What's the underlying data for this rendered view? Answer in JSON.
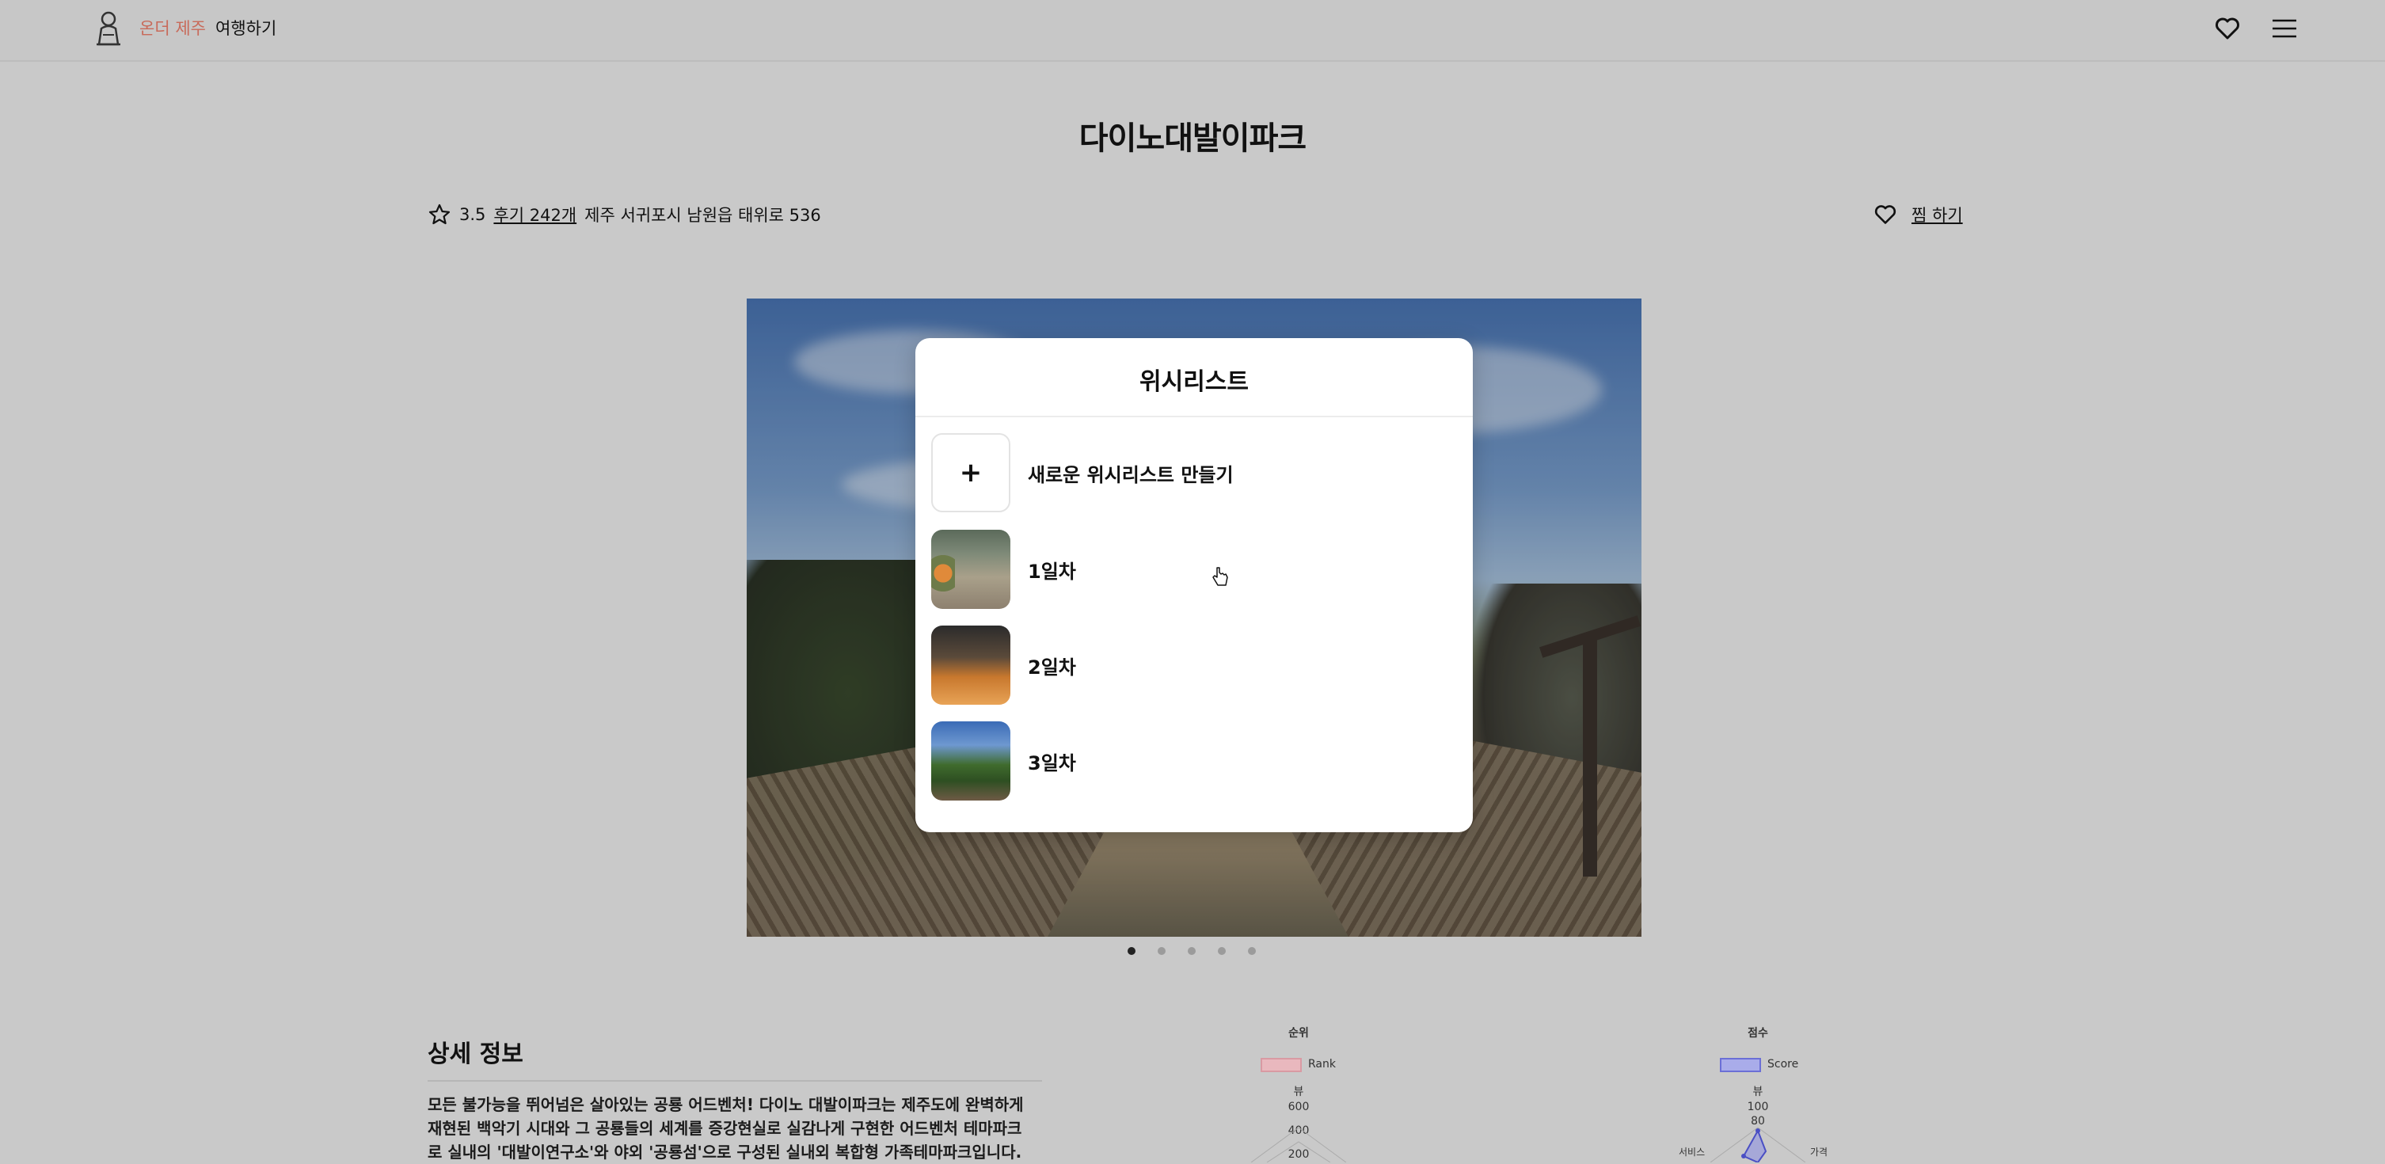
{
  "header": {
    "brand": "온더 제주",
    "nav_label": "여행하기"
  },
  "place": {
    "title": "다이노대발이파크",
    "rating": "3.5",
    "reviews": "후기 242개",
    "address": "제주 서귀포시 남원읍 태위로 536",
    "save_label": "찜 하기"
  },
  "carousel": {
    "total_slides": 5,
    "active_index": 0
  },
  "modal": {
    "title": "위시리스트",
    "create_label": "새로운 위시리스트 만들기",
    "items": [
      {
        "label": "1일차",
        "thumb_icon": "orange-farm-thumbnail"
      },
      {
        "label": "2일차",
        "thumb_icon": "tangerine-box-thumbnail"
      },
      {
        "label": "3일차",
        "thumb_icon": "field-path-thumbnail"
      }
    ]
  },
  "detail": {
    "title": "상세 정보",
    "lines": [
      "모든 불가능을 뛰어넘은 살아있는 공룡 어드벤처! 다이노 대발이파크는 제주도에 완벽하게",
      "재현된 백악기 시대와 그 공룡들의 세계를 증강현실로 실감나게 구현한 어드벤처 테마파크",
      "로 실내의 '대발이연구소'와 야외 '공룡섬'으로 구성된 실내외 복합형 가족테마파크입니다."
    ]
  },
  "charts": [
    {
      "title": "순위",
      "legend": "Rank",
      "axis_label_top": "뷰",
      "ticks": [
        "600",
        "400",
        "200"
      ],
      "color": "#e58f9a"
    },
    {
      "title": "점수",
      "legend": "Score",
      "axis_label_top": "뷰",
      "ticks": [
        "100",
        "80"
      ],
      "side_labels": [
        "서비스",
        "가격"
      ],
      "color": "#6b6fd6"
    }
  ]
}
